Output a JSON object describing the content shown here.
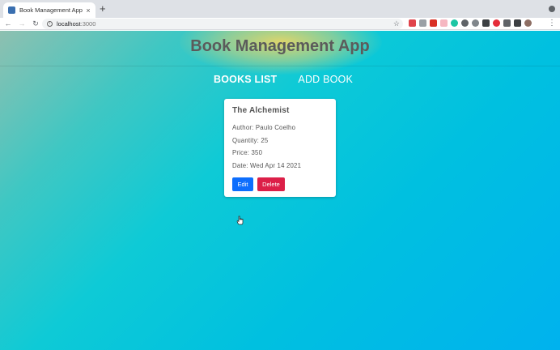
{
  "browser": {
    "tab_title": "Book Management App",
    "tab_close": "×",
    "new_tab": "+",
    "url_host": "localhost",
    "url_port": ":3000",
    "icons": [
      "back-arrow-icon",
      "forward-arrow-icon",
      "reload-icon",
      "info-icon",
      "star-icon",
      "menu-dots-icon"
    ]
  },
  "app": {
    "title": "Book Management App",
    "nav": [
      {
        "label": "BOOKS LIST",
        "active": true
      },
      {
        "label": "ADD BOOK",
        "active": false
      }
    ]
  },
  "book": {
    "title": "The Alchemist",
    "author": "Author: Paulo Coelho",
    "quantity": "Quantity: 25",
    "price": "Price: 350",
    "date": "Date: Wed Apr 14 2021",
    "edit_label": "Edit",
    "delete_label": "Delete"
  },
  "colors": {
    "edit_button": "#0d6efd",
    "delete_button": "#dc1f48",
    "gradient_start": "#8ec0b0",
    "gradient_end": "#00b2ee"
  }
}
